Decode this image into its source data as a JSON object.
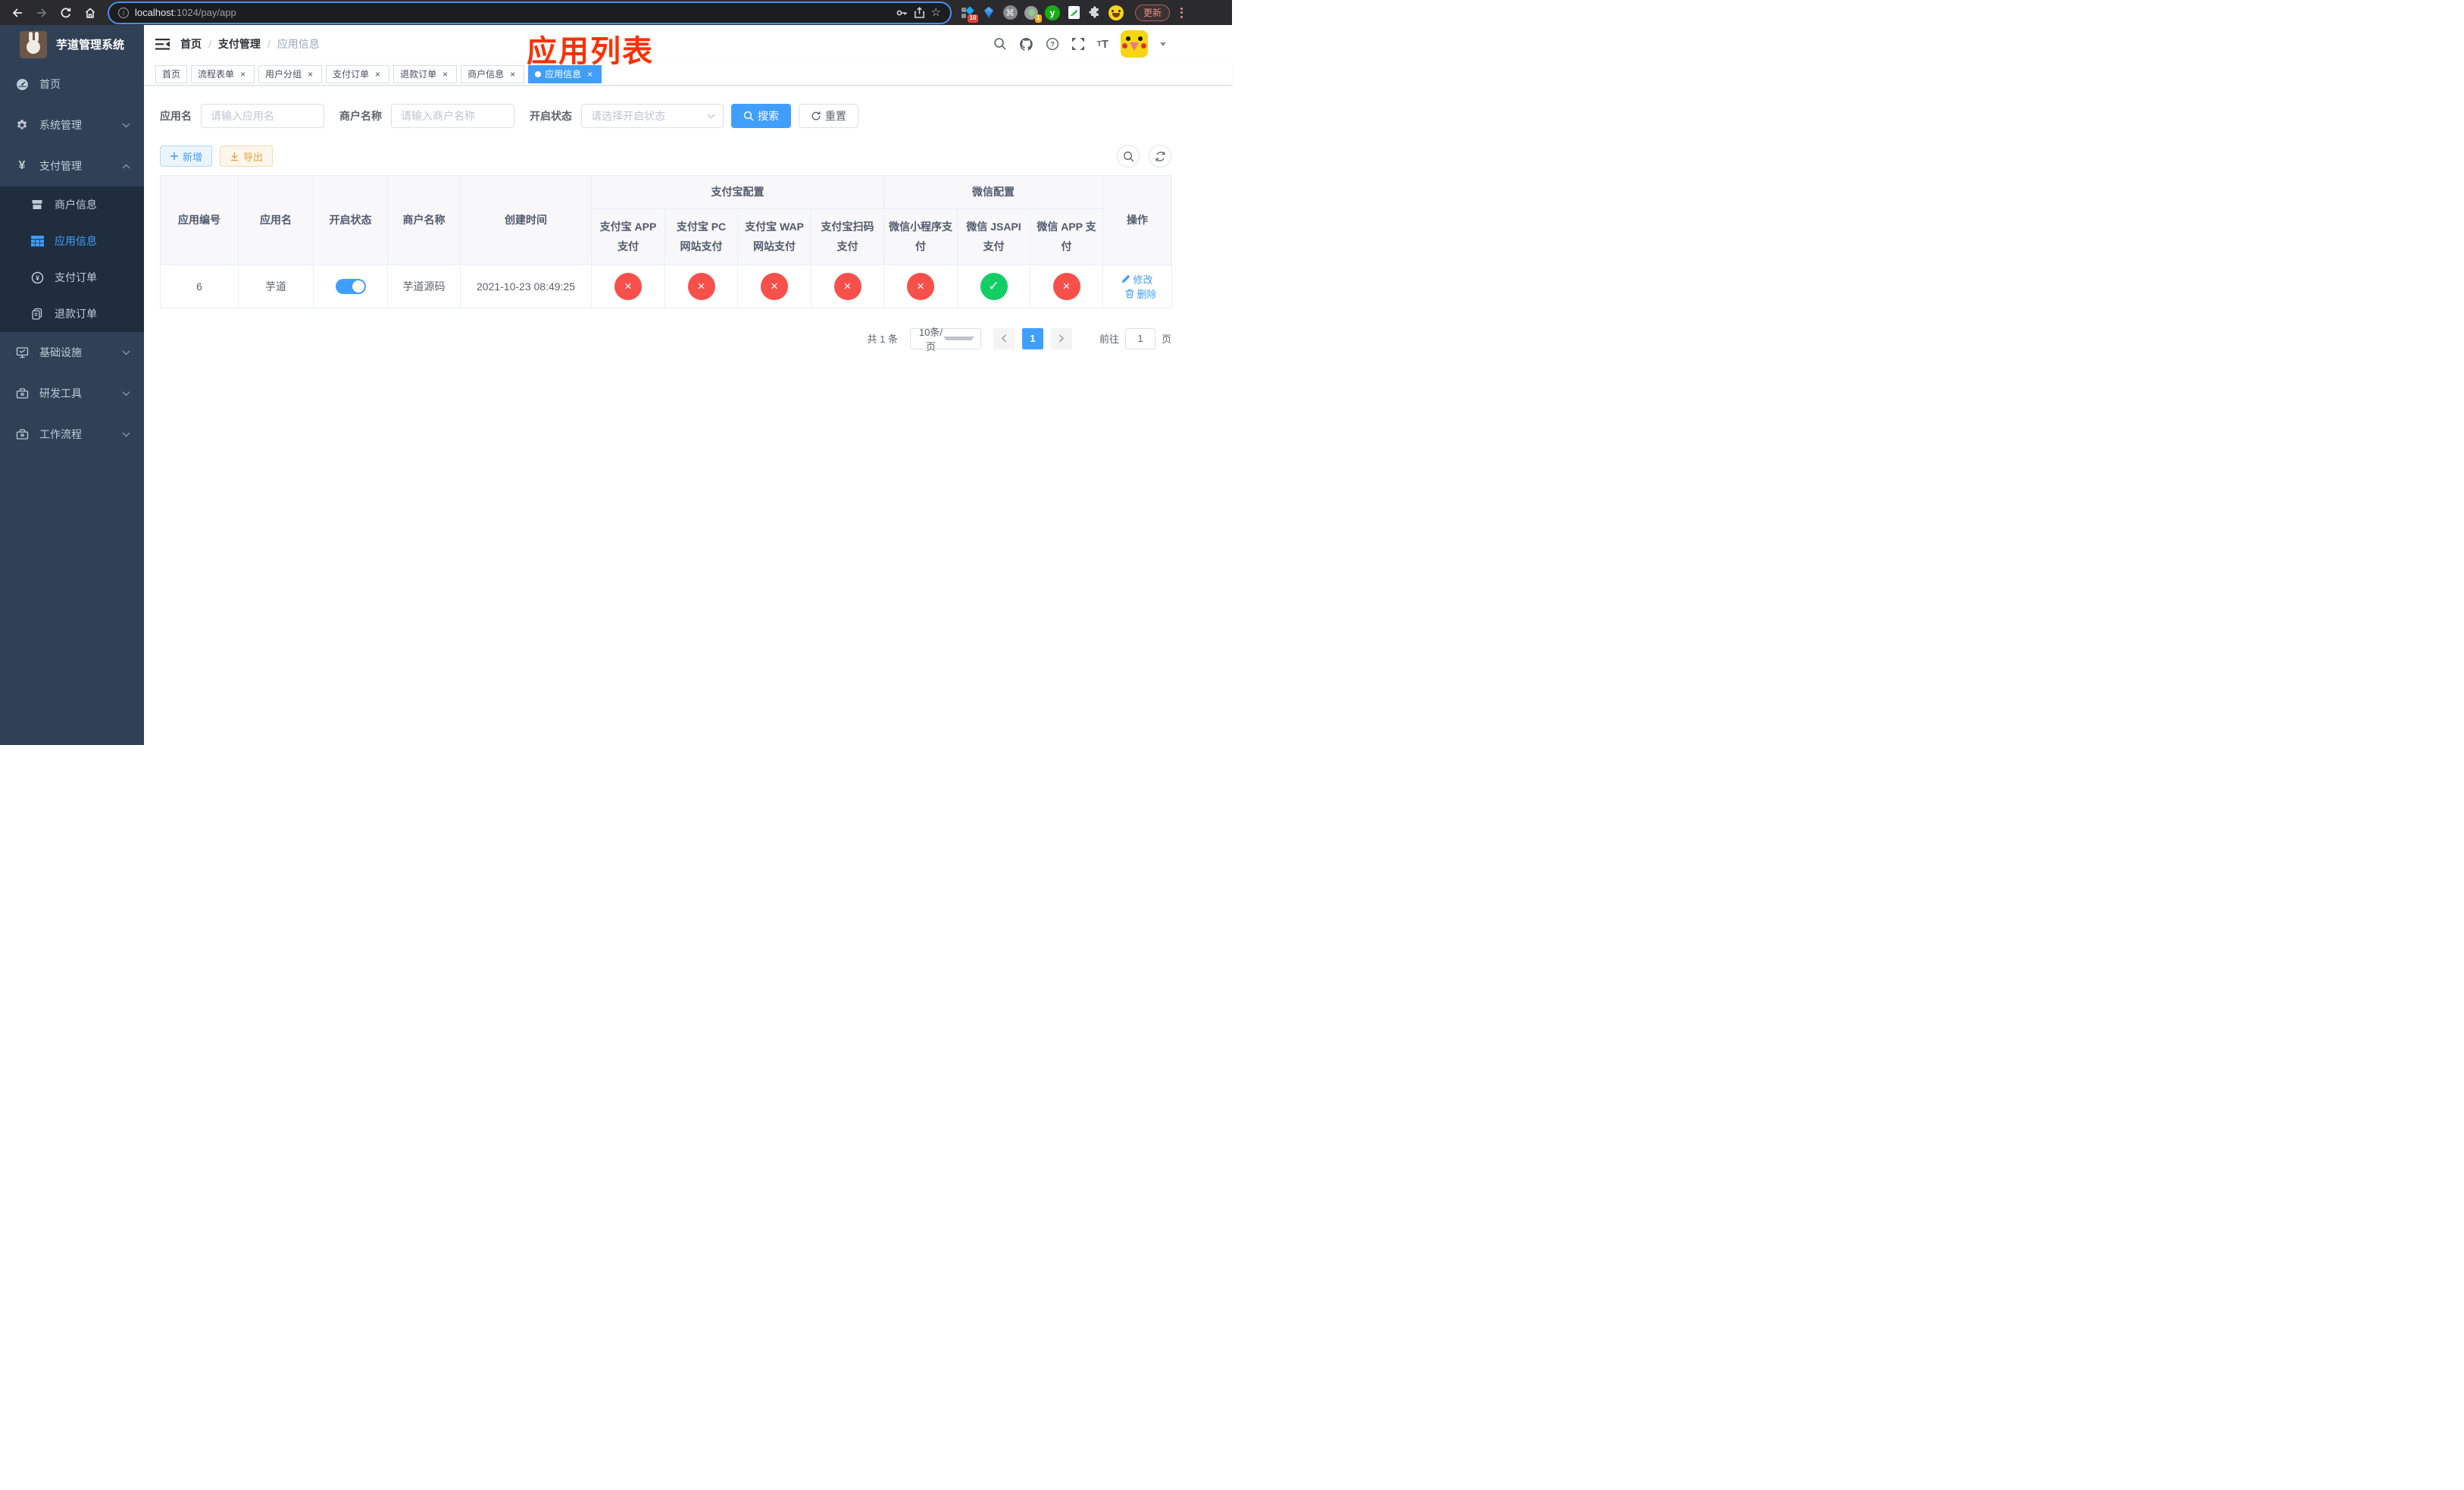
{
  "colors": {
    "accent": "#409eff",
    "success": "#13ce66",
    "danger": "#f7504b",
    "warning": "#e6a23c",
    "sidebar_bg": "#304156",
    "submenu_bg": "#1f2d3d",
    "annotation_red": "#ff3000"
  },
  "browser": {
    "url_host": "localhost",
    "url_path": ":1024/pay/app",
    "update_button": "更新",
    "ext_badge_grid": "10",
    "ext_badge_ring": "1",
    "ext_y_letter": "y",
    "command_symbol": "⌘",
    "star_symbol": "☆"
  },
  "sidebar": {
    "app_title": "芋道管理系统",
    "items": [
      {
        "label": "首页",
        "icon": "dashboard-icon"
      },
      {
        "label": "系统管理",
        "icon": "gear-icon",
        "chevron": "down"
      },
      {
        "label": "支付管理",
        "icon": "yen-icon",
        "chevron": "up"
      },
      {
        "label": "基础设施",
        "icon": "monitor-icon",
        "chevron": "down"
      },
      {
        "label": "研发工具",
        "icon": "toolbox-icon",
        "chevron": "down"
      },
      {
        "label": "工作流程",
        "icon": "toolbox-icon",
        "chevron": "down"
      }
    ],
    "yen_glyph": "¥",
    "submenu": [
      {
        "label": "商户信息",
        "icon": "shop-icon"
      },
      {
        "label": "应用信息",
        "icon": "grid-icon",
        "active": true
      },
      {
        "label": "支付订单",
        "icon": "pay-order-icon"
      },
      {
        "label": "退款订单",
        "icon": "refund-icon"
      }
    ]
  },
  "navbar": {
    "breadcrumb": [
      "首页",
      "支付管理",
      "应用信息"
    ],
    "separator": "/",
    "annotation": "应用列表",
    "fontsize_small": "T",
    "fontsize_big": "T",
    "help_symbol": "?"
  },
  "tabs": {
    "close_symbol": "×",
    "items": [
      {
        "label": "首页",
        "closable": false
      },
      {
        "label": "流程表单",
        "closable": true
      },
      {
        "label": "用户分组",
        "closable": true
      },
      {
        "label": "支付订单",
        "closable": true
      },
      {
        "label": "退款订单",
        "closable": true
      },
      {
        "label": "商户信息",
        "closable": true
      },
      {
        "label": "应用信息",
        "closable": true,
        "active": true
      }
    ]
  },
  "search": {
    "app_name_label": "应用名",
    "app_name_placeholder": "请输入应用名",
    "merchant_label": "商户名称",
    "merchant_placeholder": "请输入商户名称",
    "status_label": "开启状态",
    "status_placeholder": "请选择开启状态",
    "search_button": "搜索",
    "reset_button": "重置"
  },
  "toolbar": {
    "add_button": "新增",
    "export_button": "导出"
  },
  "table": {
    "headers": {
      "app_id": "应用编号",
      "app_name": "应用名",
      "open_status": "开启状态",
      "merchant_name": "商户名称",
      "create_time": "创建时间",
      "alipay_group": "支付宝配置",
      "wechat_group": "微信配置",
      "actions": "操作"
    },
    "alipay_columns": [
      "支付宝 APP 支付",
      "支付宝 PC 网站支付",
      "支付宝 WAP 网站支付",
      "支付宝扫码支付"
    ],
    "wechat_columns": [
      "微信小程序支付",
      "微信 JSAPI 支付",
      "微信 APP 支付"
    ],
    "row": {
      "app_id": "6",
      "app_name": "芋道",
      "open_status": "on",
      "merchant_name": "芋道源码",
      "create_time": "2021-10-23 08:49:25",
      "gateways": [
        {
          "name": "支付宝 APP 支付",
          "state": "off",
          "symbol": "×"
        },
        {
          "name": "支付宝 PC 网站支付",
          "state": "off",
          "symbol": "×"
        },
        {
          "name": "支付宝 WAP 网站支付",
          "state": "off",
          "symbol": "×"
        },
        {
          "name": "支付宝扫码支付",
          "state": "off",
          "symbol": "×"
        },
        {
          "name": "微信小程序支付",
          "state": "off",
          "symbol": "×"
        },
        {
          "name": "微信 JSAPI 支付",
          "state": "on",
          "symbol": "✓"
        },
        {
          "name": "微信 APP 支付",
          "state": "off",
          "symbol": "×"
        }
      ],
      "edit_action": "修改",
      "delete_action": "删除"
    }
  },
  "pagination": {
    "total": "共 1 条",
    "page_size": "10条/页",
    "current_page": "1",
    "goto_label": "前往",
    "goto_value": "1",
    "page_unit": "页"
  }
}
